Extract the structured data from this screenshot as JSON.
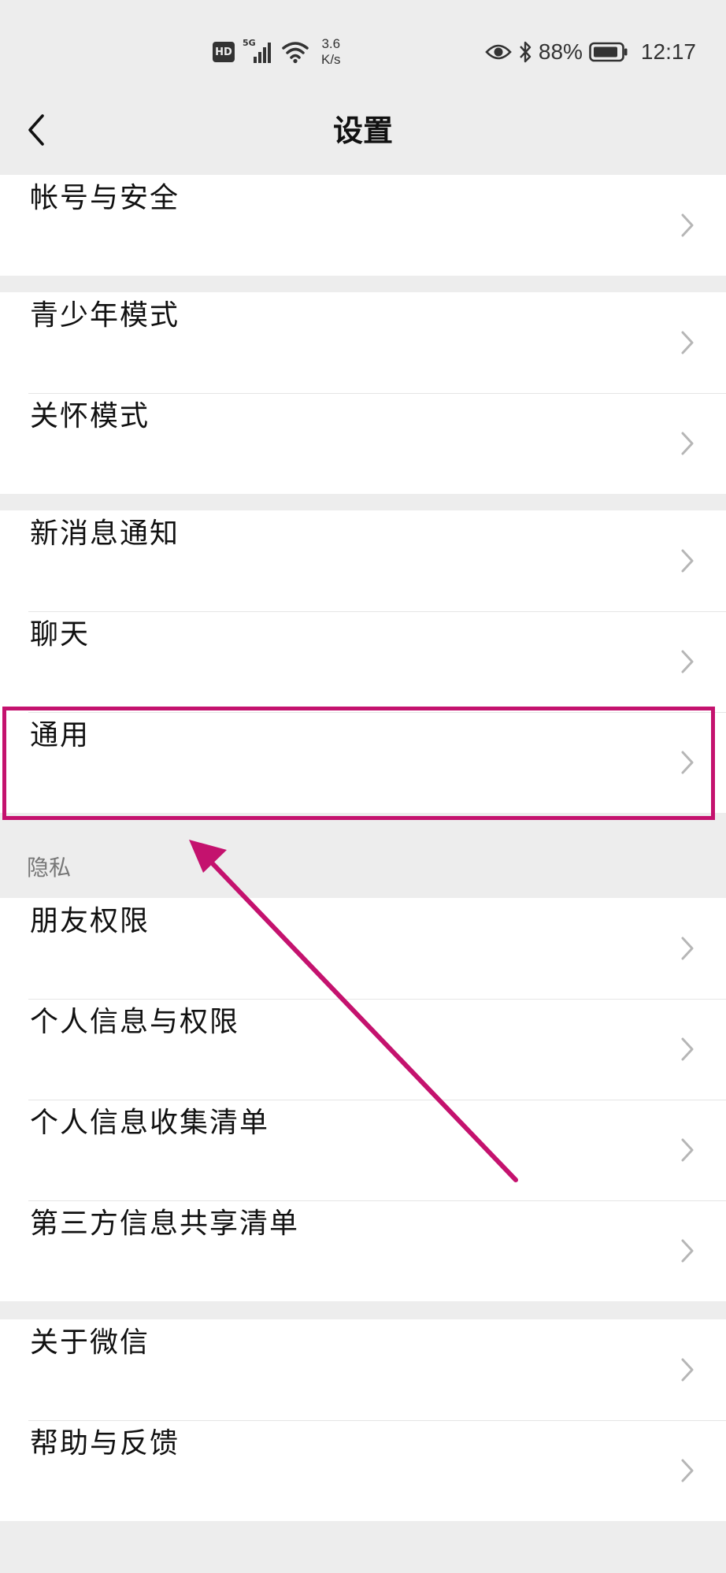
{
  "status_bar": {
    "hd": "HD",
    "net_type": "5G",
    "speed_value": "3.6",
    "speed_unit": "K/s",
    "battery": "88%",
    "time": "12:17"
  },
  "nav": {
    "title": "设置"
  },
  "groups": [
    {
      "items": [
        {
          "label": "帐号与安全"
        }
      ]
    },
    {
      "items": [
        {
          "label": "青少年模式"
        },
        {
          "label": "关怀模式"
        }
      ]
    },
    {
      "items": [
        {
          "label": "新消息通知"
        },
        {
          "label": "聊天"
        },
        {
          "label": "通用"
        }
      ]
    },
    {
      "header": "隐私",
      "items": [
        {
          "label": "朋友权限"
        },
        {
          "label": "个人信息与权限"
        },
        {
          "label": "个人信息收集清单"
        },
        {
          "label": "第三方信息共享清单"
        }
      ]
    },
    {
      "items": [
        {
          "label": "关于微信"
        },
        {
          "label": "帮助与反馈"
        }
      ]
    }
  ],
  "annotation": {
    "highlighted_item": "通用",
    "color": "#c4126e"
  }
}
